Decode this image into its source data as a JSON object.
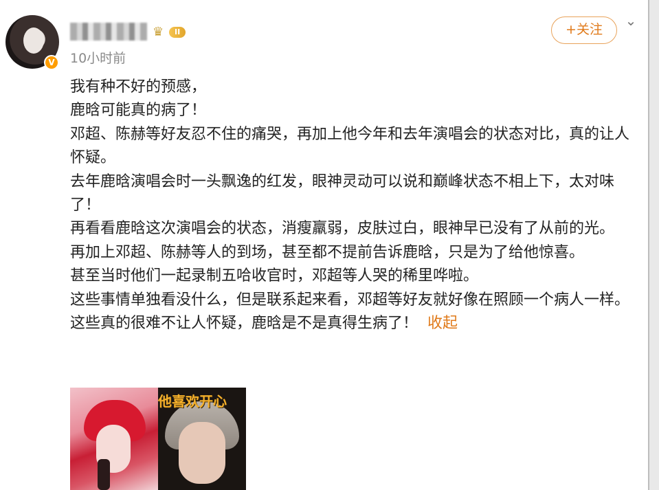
{
  "header": {
    "time": "10小时前",
    "level_badge": "II",
    "verified_mark": "V",
    "follow_label": "+关注"
  },
  "post": {
    "lines": [
      "我有种不好的预感，",
      "鹿晗可能真的病了！",
      "邓超、陈赫等好友忍不住的痛哭，再加上他今年和去年演唱会的状态对比，真的让人怀疑。",
      "去年鹿晗演唱会时一头飘逸的红发，眼神灵动可以说和巅峰状态不相上下，太对味了！",
      "再看看鹿晗这次演唱会的状态，消瘦羸弱，皮肤过白，眼神早已没有了从前的光。",
      "再加上邓超、陈赫等人的到场，甚至都不提前告诉鹿晗，只是为了给他惊喜。",
      "甚至当时他们一起录制五哈收官时，邓超等人哭的稀里哗啦。",
      "这些事情单独看没什么，但是联系起来看，邓超等好友就好像在照顾一个病人一样。",
      "这些真的很难不让人怀疑，鹿晗是不是真得生病了！"
    ],
    "collapse_label": "收起"
  },
  "images": {
    "caption": "他喜欢开心"
  },
  "icons": {
    "chevron": "chevron-down-icon",
    "crown": "crown-icon"
  },
  "colors": {
    "accent": "#e07a1a",
    "time": "#8a8a8a",
    "text": "#222222"
  }
}
